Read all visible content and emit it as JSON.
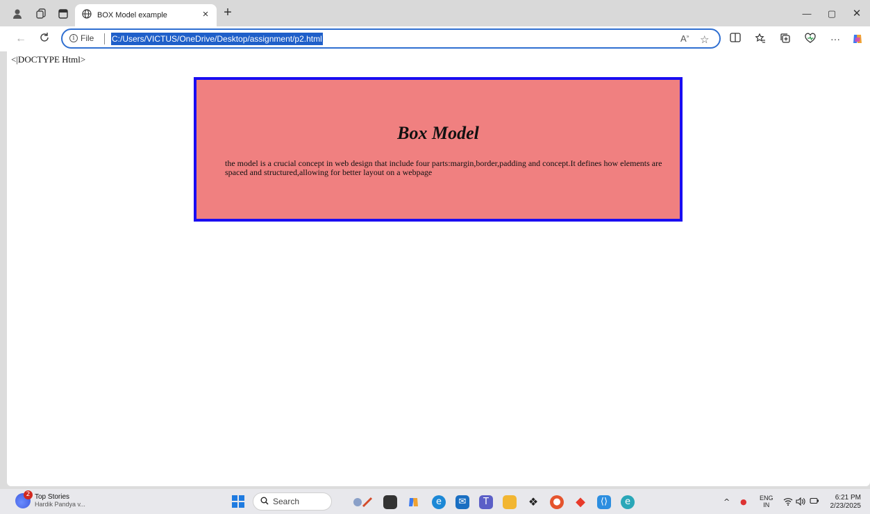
{
  "browser": {
    "tab_title": "BOX Model example",
    "address": {
      "scheme_label": "File",
      "url": "C:/Users/VICTUS/OneDrive/Desktop/assignment/p2.html"
    }
  },
  "page": {
    "doctype_text": "<|DOCTYPE Html>",
    "box": {
      "title": "Box Model",
      "body": "the model is a crucial concept in web design that include four parts:margin,border,padding and concept.It defines how elements are spaced and structured,allowing for better layout on a webpage",
      "background_color": "#f08080",
      "border_color": "#1a0df2"
    }
  },
  "taskbar": {
    "news": {
      "badge_count": "2",
      "title": "Top Stories",
      "subtitle": "Hardik Pandya v..."
    },
    "search_label": "Search",
    "language": {
      "line1": "ENG",
      "line2": "IN"
    },
    "clock": {
      "time": "6:21 PM",
      "date": "2/23/2025"
    }
  }
}
